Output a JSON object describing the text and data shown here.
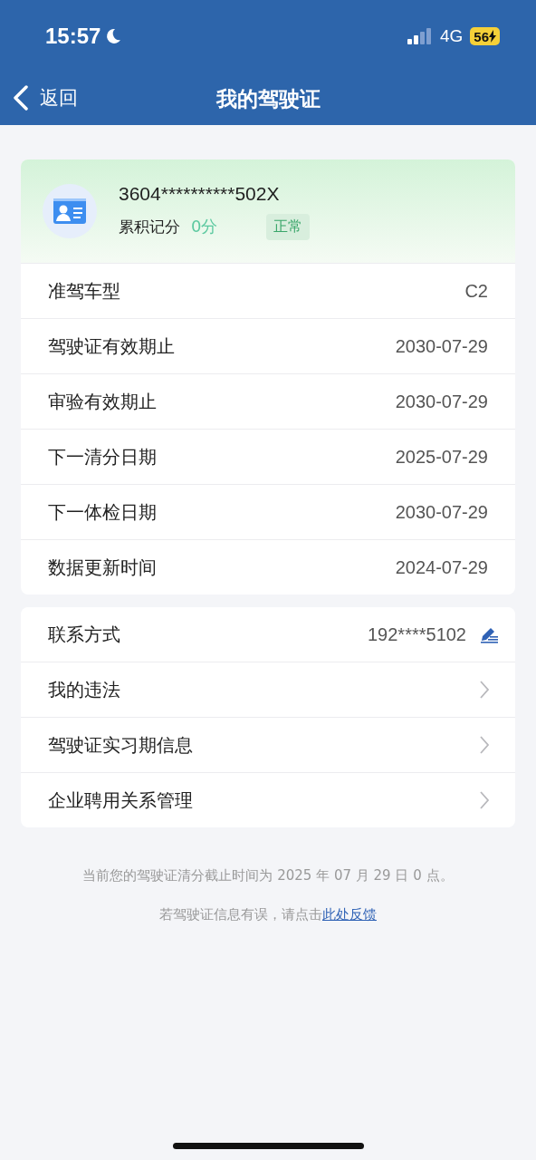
{
  "status_bar": {
    "time": "15:57",
    "network": "4G",
    "battery": "56"
  },
  "nav": {
    "back": "返回",
    "title": "我的驾驶证"
  },
  "license": {
    "number": "3604**********502X",
    "points_label": "累积记分",
    "points": "0分",
    "status": "正常"
  },
  "details": [
    {
      "label": "准驾车型",
      "value": "C2"
    },
    {
      "label": "驾驶证有效期止",
      "value": "2030-07-29"
    },
    {
      "label": "审验有效期止",
      "value": "2030-07-29"
    },
    {
      "label": "下一清分日期",
      "value": "2025-07-29"
    },
    {
      "label": "下一体检日期",
      "value": "2030-07-29"
    },
    {
      "label": "数据更新时间",
      "value": "2024-07-29"
    }
  ],
  "actions": [
    {
      "kind": "edit",
      "label": "联系方式",
      "value": "192****5102"
    },
    {
      "kind": "link",
      "label": "我的违法"
    },
    {
      "kind": "link",
      "label": "驾驶证实习期信息"
    },
    {
      "kind": "link",
      "label": "企业聘用关系管理"
    }
  ],
  "notice": "当前您的驾驶证清分截止时间为 2025 年 07 月 29 日 0 点。",
  "feedback": {
    "text": "若驾驶证信息有误，请点击",
    "link": "此处反馈"
  }
}
